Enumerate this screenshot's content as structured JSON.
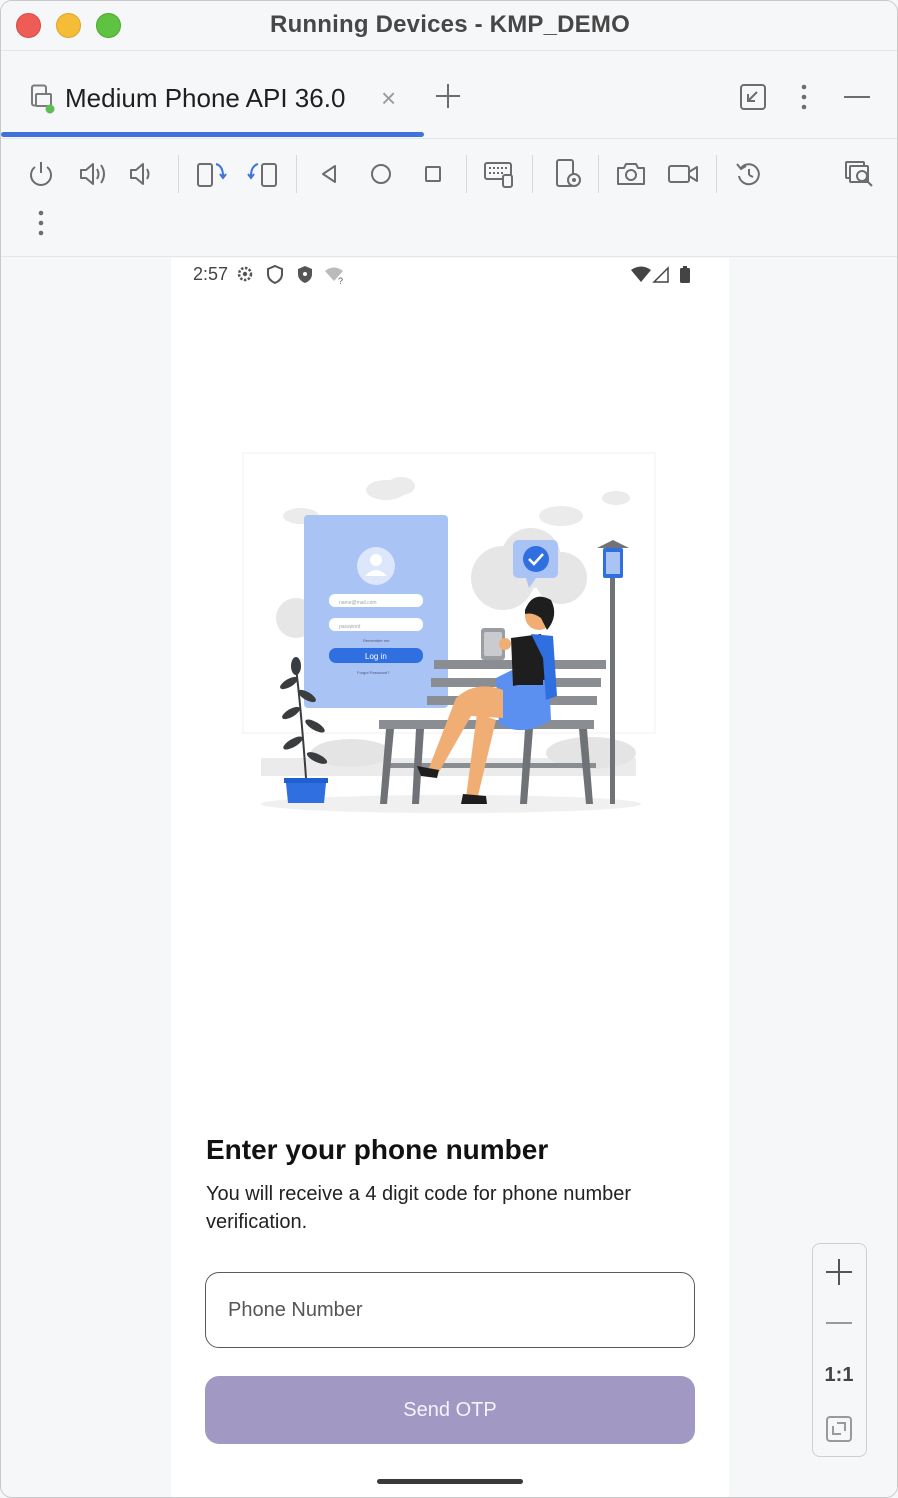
{
  "window": {
    "title": "Running Devices - KMP_DEMO"
  },
  "tabbar": {
    "active_tab_label": "Medium Phone API 36.0",
    "close_icon": "×",
    "add_icon": "add-tab-icon"
  },
  "toolbar": {
    "icons": [
      "power-icon",
      "volume-up-icon",
      "volume-down-icon",
      "rotate-left-icon",
      "rotate-right-icon",
      "back-icon",
      "home-icon",
      "overview-icon",
      "keyboard-icon",
      "device-settings-icon",
      "screenshot-icon",
      "screen-record-icon",
      "reset-icon",
      "layout-inspector-icon",
      "more-icon"
    ]
  },
  "phone": {
    "status_time": "2:57",
    "heading": "Enter your phone number",
    "subtext": "You will receive a 4 digit code for phone number verification.",
    "input_placeholder": "Phone Number",
    "input_value": "",
    "send_button_label": "Send OTP",
    "send_button_color": "#a199c4",
    "illustration": {
      "email_placeholder": "name@mail.com",
      "password_placeholder": "password",
      "remember_text": "Remember me",
      "login_label": "Log in",
      "forgot_text": "Forgot Password?"
    }
  },
  "zoom": {
    "plus": "+",
    "minus": "—",
    "one_to_one": "1:1"
  },
  "colors": {
    "accent": "#3f73db",
    "illustration_blue": "#2f6fe0",
    "card_blue": "#a9c3f5"
  }
}
